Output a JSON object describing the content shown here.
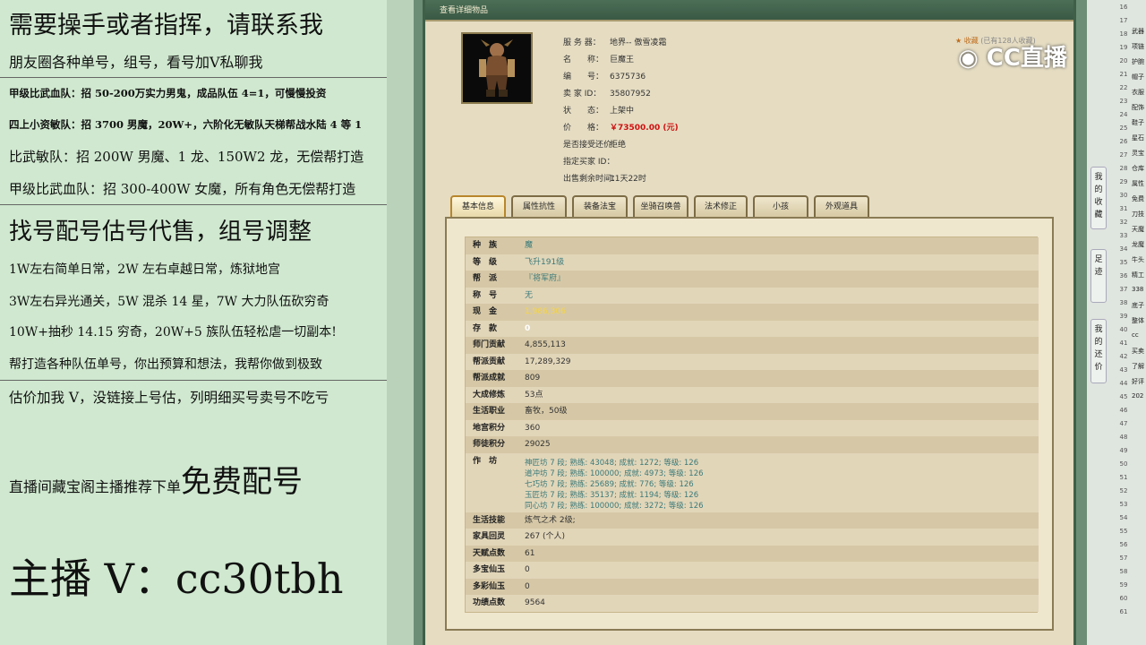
{
  "promo": {
    "l1": "需要操手或者指挥，请联系我",
    "l2": "朋友圈各种单号，组号，看号加V私聊我",
    "l3": "甲级比武血队：招 50-200万实力男鬼，成品队伍 4=1，可慢慢投资",
    "l4": "四上小资敏队：招 3700 男魔，20W+，六阶化无敏队天梯帮战水陆 4 等 1",
    "l5": "比武敏队：招 200W 男魔、1 龙、150W2 龙，无偿帮打造",
    "l6": "甲级比武血队：招 300-400W 女魔，所有角色无偿帮打造",
    "l7": "找号配号估号代售，组号调整",
    "l8": "1W左右简单日常，2W 左右卓越日常，炼狱地宫",
    "l9": "3W左右异光通关，5W 混杀 14 星，7W 大力队伍砍穷奇",
    "l10": "10W+抽秒 14.15 穷奇，20W+5 族队伍轻松虐一切副本!",
    "l11": "帮打造各种队伍单号，你出预算和想法，我帮你做到极致",
    "l12": "估价加我 V，没链接上号估，列明细买号卖号不吃亏",
    "l13a": "直播间藏宝阁主播推荐下单",
    "l13b": "免费配号",
    "l14": "主播 V：cc30tbh"
  },
  "window": {
    "title": "查看详细物品",
    "fav_label": "收藏",
    "fav_count": "(已有128人收藏)",
    "info": [
      {
        "k": "服 务 器：",
        "v": "地界-- 傲雪凌霜"
      },
      {
        "k": "名　　称：",
        "v": "巨魔王"
      },
      {
        "k": "编　　号：",
        "v": "6375736"
      },
      {
        "k": "卖 家 ID：",
        "v": "35807952"
      },
      {
        "k": "状　　态：",
        "v": "上架中"
      },
      {
        "k": "价　　格：",
        "v": "￥73500.00 (元)"
      },
      {
        "k": "是否接受还价：",
        "v": "拒绝"
      },
      {
        "k": "指定买家 ID：",
        "v": ""
      },
      {
        "k": "出售剩余时间：",
        "v": "11天22时"
      }
    ],
    "tabs": [
      "基本信息",
      "属性抗性",
      "装备法宝",
      "坐骑召唤兽",
      "法术修正",
      "小孩",
      "外观道具"
    ],
    "rows": [
      {
        "k": "种　族",
        "v": "魔"
      },
      {
        "k": "等　级",
        "v": "飞升191级"
      },
      {
        "k": "帮　派",
        "v": "『将军府』"
      },
      {
        "k": "称　号",
        "v": "无"
      },
      {
        "k": "现　金",
        "v": "1,986,306"
      },
      {
        "k": "存　款",
        "v": "0"
      },
      {
        "k": "师门贡献",
        "v": "4,855,113"
      },
      {
        "k": "帮派贡献",
        "v": "17,289,329"
      },
      {
        "k": "帮派成就",
        "v": "809"
      },
      {
        "k": "大成修炼",
        "v": "53点"
      },
      {
        "k": "生活职业",
        "v": "畜牧，50级"
      },
      {
        "k": "地宫积分",
        "v": "360"
      },
      {
        "k": "师徒积分",
        "v": "29025"
      },
      {
        "k": "作　坊",
        "v": ""
      },
      {
        "k": "生活技能",
        "v": "炼气之术 2级;"
      },
      {
        "k": "家具回灵",
        "v": "267 (个人)"
      },
      {
        "k": "天赋点数",
        "v": "61"
      },
      {
        "k": "多宝仙玉",
        "v": "0"
      },
      {
        "k": "多彩仙玉",
        "v": "0"
      },
      {
        "k": "功绩点数",
        "v": "9564"
      }
    ],
    "craft": [
      "神匠坊 7 段;  熟练: 43048;  成就: 1272;  等级: 126",
      "道冲坊 7 段;  熟练: 100000;  成就: 4973;  等级: 126",
      "七巧坊 7 段;  熟练: 25689;  成就: 776;  等级: 126",
      "玉匠坊 7 段;  熟练: 35137;  成就: 1194;  等级: 126",
      "同心坊 7 段;  熟练: 100000;  成就: 3272;  等级: 126"
    ]
  },
  "side": {
    "btn1": "我的收藏",
    "btn2": "足迹",
    "btn3": "我的还价",
    "logo": "CC直播",
    "rows": [
      "16",
      "17",
      "18",
      "19",
      "20",
      "21",
      "22",
      "23",
      "24",
      "25",
      "26",
      "27",
      "28",
      "29",
      "30",
      "31",
      "32",
      "33",
      "34",
      "35",
      "36",
      "37",
      "38",
      "39",
      "40",
      "41",
      "42",
      "43",
      "44",
      "45",
      "46",
      "47",
      "48",
      "49",
      "50",
      "51",
      "52",
      "53",
      "54",
      "55",
      "56",
      "57",
      "58",
      "59",
      "60",
      "61"
    ],
    "cells": [
      "武器",
      "项链",
      "护腕",
      "帽子",
      "衣服",
      "配饰",
      "鞋子",
      "星石",
      "灵宝",
      "仓库",
      "属性",
      "免费",
      "刀技",
      "天魔",
      "龙魔",
      "牛头",
      "精工",
      "338",
      "底子",
      "整体",
      "cc",
      "买卖",
      "了解",
      "好评",
      "202"
    ]
  },
  "colors": {
    "price": "#d01010",
    "cash": "#f5d44a",
    "craft": "#3a7a7a",
    "accent": "#b8862b"
  }
}
